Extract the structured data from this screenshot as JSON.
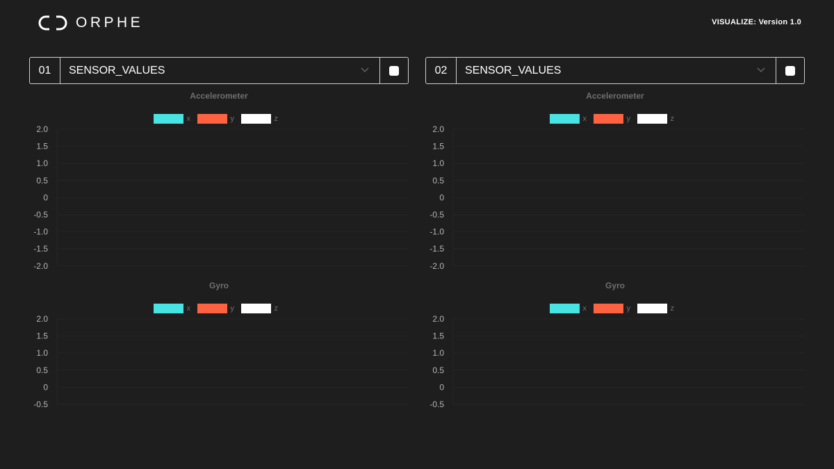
{
  "header": {
    "logo_text": "ORPHE",
    "version": "VISUALIZE: Version 1.0"
  },
  "colors": {
    "x": "#48e3e3",
    "y": "#ff6240",
    "z": "#ffffff",
    "background": "#1e1e1e",
    "grid": "#252525"
  },
  "panels": [
    {
      "number": "01",
      "dropdown_value": "SENSOR_VALUES",
      "accel": {
        "title": "Accelerometer",
        "legend": [
          "x",
          "y",
          "z"
        ],
        "y_ticks": [
          "2.0",
          "1.5",
          "1.0",
          "0.5",
          "0",
          "-0.5",
          "-1.0",
          "-1.5",
          "-2.0"
        ]
      },
      "gyro": {
        "title": "Gyro",
        "legend": [
          "x",
          "y",
          "z"
        ],
        "y_ticks": [
          "2.0",
          "1.5",
          "1.0",
          "0.5",
          "0",
          "-0.5"
        ]
      }
    },
    {
      "number": "02",
      "dropdown_value": "SENSOR_VALUES",
      "accel": {
        "title": "Accelerometer",
        "legend": [
          "x",
          "y",
          "z"
        ],
        "y_ticks": [
          "2.0",
          "1.5",
          "1.0",
          "0.5",
          "0",
          "-0.5",
          "-1.0",
          "-1.5",
          "-2.0"
        ]
      },
      "gyro": {
        "title": "Gyro",
        "legend": [
          "x",
          "y",
          "z"
        ],
        "y_ticks": [
          "2.0",
          "1.5",
          "1.0",
          "0.5",
          "0",
          "-0.5"
        ]
      }
    }
  ]
}
